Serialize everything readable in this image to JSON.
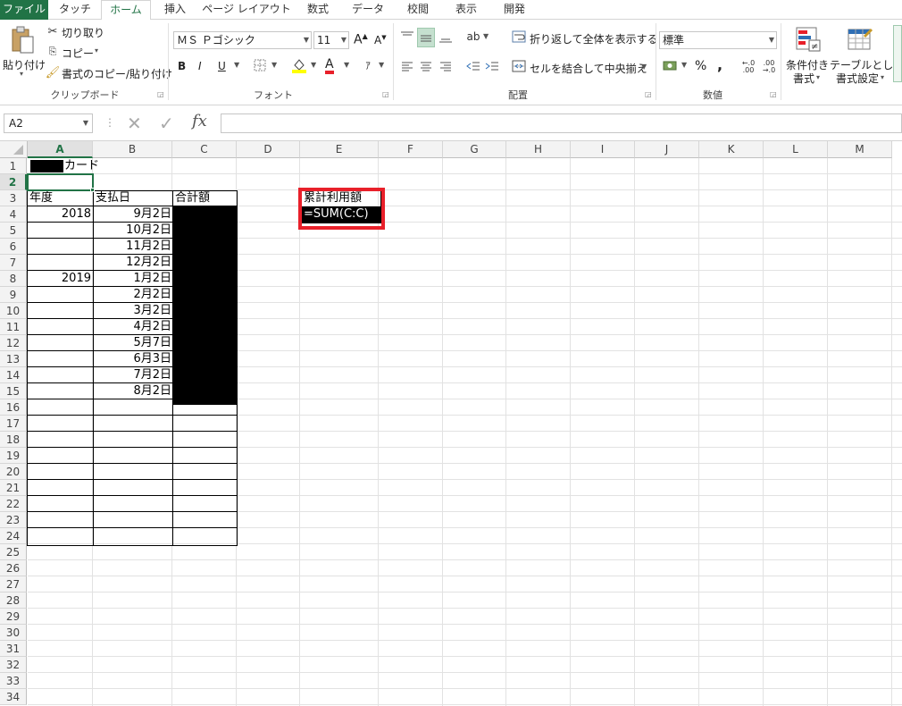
{
  "ribbon": {
    "tabs": [
      "ファイル",
      "タッチ",
      "ホーム",
      "挿入",
      "ページ レイアウト",
      "数式",
      "データ",
      "校閲",
      "表示",
      "開発"
    ],
    "clipboard": {
      "paste": "貼り付け",
      "cut": "切り取り",
      "copy": "コピー",
      "format_painter": "書式のコピー/貼り付け",
      "label": "クリップボード"
    },
    "font": {
      "name": "ＭＳ Ｐゴシック",
      "size": "11",
      "bold": "B",
      "italic": "I",
      "underline": "U",
      "grow": "A",
      "shrink": "A",
      "font_color": "A",
      "label": "フォント"
    },
    "alignment": {
      "wrap_text": "折り返して全体を表示する",
      "merge_center": "セルを結合して中央揃え",
      "label": "配置"
    },
    "number": {
      "format": "標準",
      "percent": "%",
      "comma": ",",
      "inc_decimal": ".0\n.00",
      "dec_decimal": ".00\n.0",
      "label": "数値"
    },
    "styles": {
      "conditional_line1": "条件付き",
      "conditional_line2": "書式",
      "table_line1": "テーブルとして",
      "table_line2": "書式設定"
    }
  },
  "formula_bar": {
    "name_box": "A2",
    "fx": "fx",
    "cancel": "✕",
    "enter": "✓",
    "formula": ""
  },
  "grid": {
    "columns": [
      "A",
      "B",
      "C",
      "D",
      "E",
      "F",
      "G",
      "H",
      "I",
      "J",
      "K",
      "L",
      "M"
    ],
    "rows": [
      "1",
      "2",
      "3",
      "4",
      "5",
      "6",
      "7",
      "8",
      "9",
      "10",
      "11",
      "12",
      "13",
      "14",
      "15",
      "16",
      "17",
      "18",
      "19",
      "20",
      "21",
      "22",
      "23",
      "24",
      "25",
      "26",
      "27",
      "28",
      "29",
      "30",
      "31",
      "32",
      "33",
      "34"
    ],
    "selected_cell": "A2",
    "title_suffix": "カード",
    "headers": {
      "year": "年度",
      "paydate": "支払日",
      "total": "合計額"
    },
    "years": [
      {
        "row": 4,
        "value": "2018"
      },
      {
        "row": 8,
        "value": "2019"
      }
    ],
    "paydates": [
      "9月2日",
      "10月2日",
      "11月2日",
      "12月2日",
      "1月2日",
      "2月2日",
      "3月2日",
      "4月2日",
      "5月7日",
      "6月3日",
      "7月2日",
      "8月2日"
    ],
    "summary_label": "累計利用額",
    "summary_formula": "=SUM(C:C)"
  },
  "colors": {
    "excel_green": "#217346",
    "highlight_red": "#e8202a"
  }
}
